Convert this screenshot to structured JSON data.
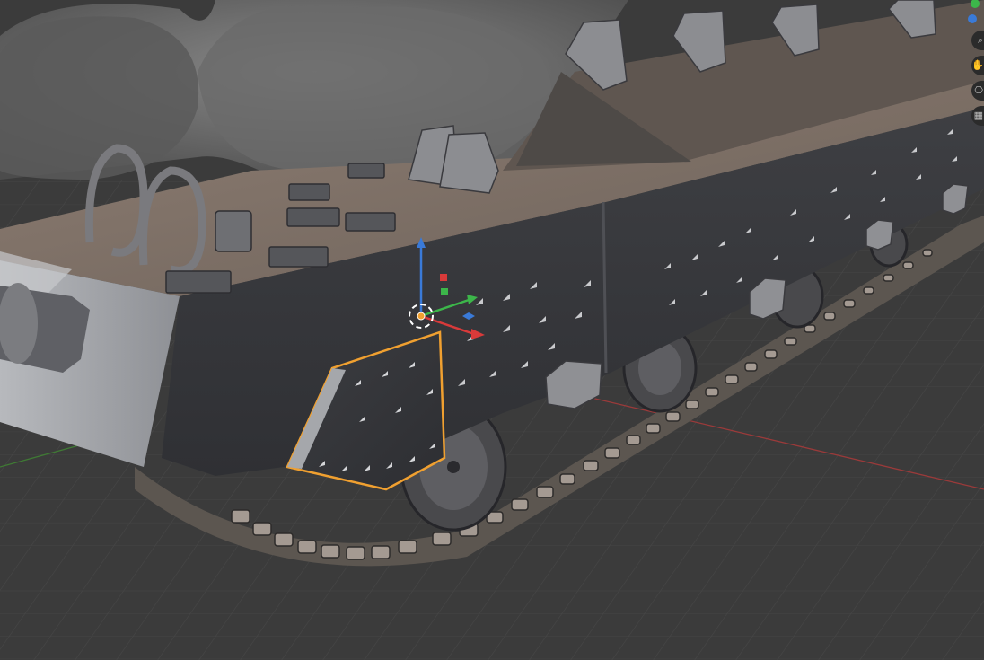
{
  "app": "3D Viewport",
  "theme": {
    "background": "#3b3b3b",
    "grid_line": "#444444",
    "x_axis": "#b8403f",
    "y_axis": "#4a8a3a",
    "selection_outline": "#f0a030",
    "gizmo_x": "#d83a3a",
    "gizmo_y": "#3cb64a",
    "gizmo_z": "#3a7ad8"
  },
  "selection": {
    "object": "armor-plate",
    "state": "selected"
  },
  "navigation_gizmo": {
    "axes": [
      "y-axis-dot",
      "z-axis-dot"
    ]
  },
  "viewport_tools": [
    {
      "name": "zoom-icon",
      "glyph": "⌕"
    },
    {
      "name": "pan-hand-icon",
      "glyph": "✋"
    },
    {
      "name": "camera-icon",
      "glyph": "⎔"
    },
    {
      "name": "perspective-grid-icon",
      "glyph": "▦"
    }
  ]
}
